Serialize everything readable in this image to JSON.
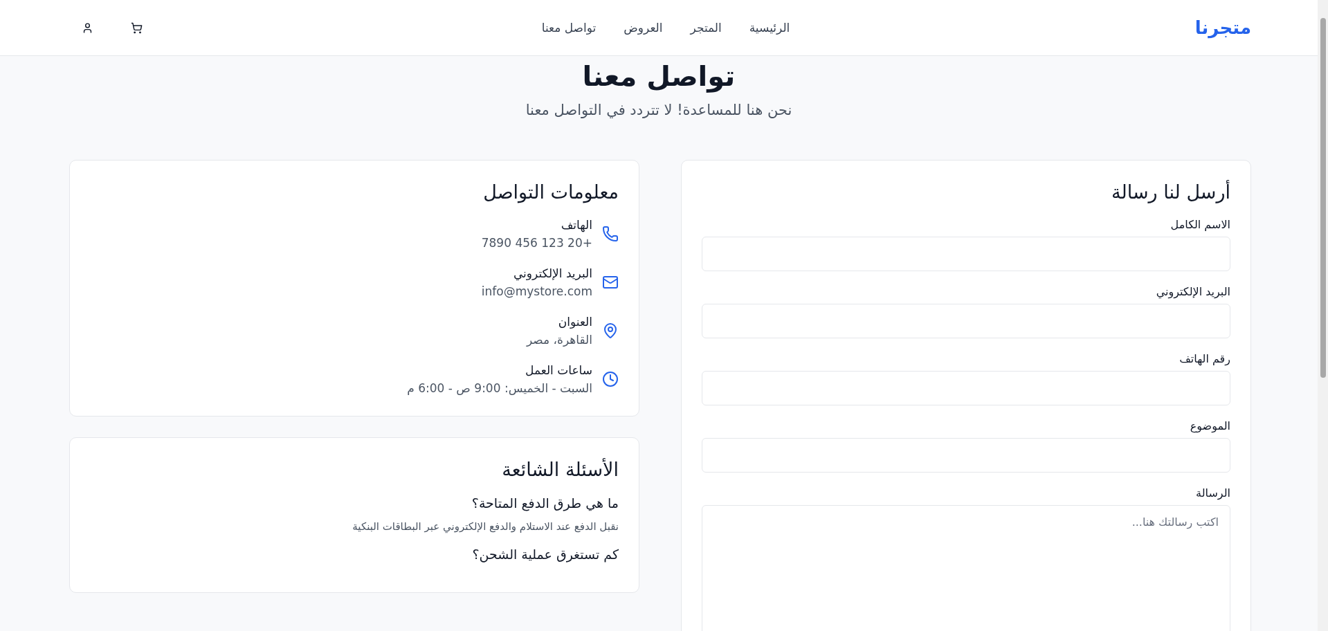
{
  "header": {
    "logo": "متجرنا",
    "nav": [
      {
        "label": "الرئيسية"
      },
      {
        "label": "المتجر"
      },
      {
        "label": "العروض"
      },
      {
        "label": "تواصل معنا"
      }
    ]
  },
  "page": {
    "title": "تواصل معنا",
    "subtitle": "نحن هنا للمساعدة! لا تتردد في التواصل معنا"
  },
  "form": {
    "title": "أرسل لنا رسالة",
    "fields": [
      {
        "label": "الاسم الكامل",
        "kind": "input"
      },
      {
        "label": "البريد الإلكتروني",
        "kind": "input"
      },
      {
        "label": "رقم الهاتف",
        "kind": "input"
      },
      {
        "label": "الموضوع",
        "kind": "input"
      },
      {
        "label": "الرسالة",
        "kind": "textarea",
        "placeholder": "اكتب رسالتك هنا..."
      }
    ]
  },
  "contact": {
    "title": "معلومات التواصل",
    "items": [
      {
        "kind": "phone",
        "label": "الهاتف",
        "value": "+20 123 456 7890"
      },
      {
        "kind": "email",
        "label": "البريد الإلكتروني",
        "value": "info@mystore.com"
      },
      {
        "kind": "address",
        "label": "العنوان",
        "value": "القاهرة، مصر"
      },
      {
        "kind": "hours",
        "label": "ساعات العمل",
        "value": "السبت - الخميس: 9:00 ص - 6:00 م"
      }
    ]
  },
  "faq": {
    "title": "الأسئلة الشائعة",
    "items": [
      {
        "question": "ما هي طرق الدفع المتاحة؟",
        "answer": "نقبل الدفع عند الاستلام والدفع الإلكتروني عبر البطاقات البنكية"
      },
      {
        "question": "كم تستغرق عملية الشحن؟"
      }
    ]
  }
}
